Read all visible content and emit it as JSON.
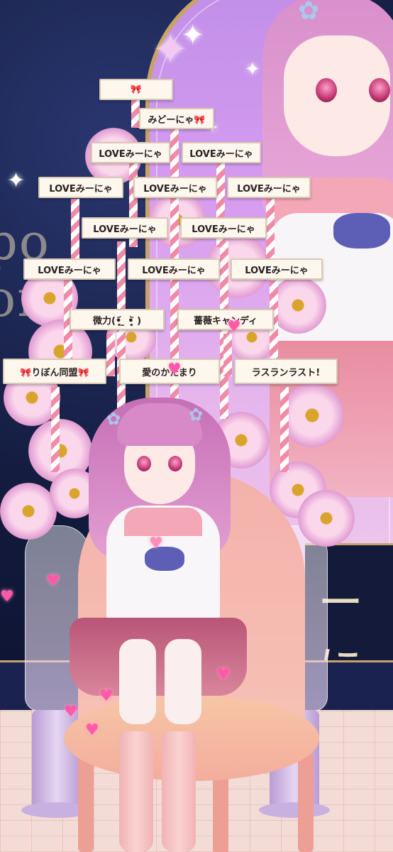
{
  "signs": [
    {
      "id": "sign-1",
      "text": "🎀"
    },
    {
      "id": "sign-2",
      "text": "みどーにゃ🎀"
    },
    {
      "id": "sign-3",
      "text": "LOVEみーにゃ"
    },
    {
      "id": "sign-4",
      "text": "LOVEみーにゃ"
    },
    {
      "id": "sign-5",
      "text": "LOVEみーにゃ"
    },
    {
      "id": "sign-6",
      "text": "LOVEみーにゃ"
    },
    {
      "id": "sign-7",
      "text": "LOVEみーにゃ"
    },
    {
      "id": "sign-8",
      "text": "LOVEみーにゃ"
    },
    {
      "id": "sign-9",
      "text": "LOVEみーにゃ"
    },
    {
      "id": "sign-10",
      "text": "LOVEみーにゃ"
    },
    {
      "id": "sign-11",
      "text": "LOVEみーにゃ"
    },
    {
      "id": "sign-12",
      "text": "LOVEみーにゃ"
    },
    {
      "id": "sign-13",
      "text": "微力(•̥̥̥̥᷄ ̫ •̥̥̥̥᷅ )"
    },
    {
      "id": "sign-14",
      "text": "薔薇キャンディ"
    },
    {
      "id": "sign-15",
      "text": "🎀りぼん同盟🎀"
    },
    {
      "id": "sign-16",
      "text": "愛のかたまり"
    },
    {
      "id": "sign-17",
      "text": "ラスランラスト!"
    }
  ],
  "background": {
    "right_panel_text": "ーに",
    "sign_colors": {
      "pole_stripe": "#f08aa6",
      "board": "#fdf7ee",
      "board_border": "#d9c9b4"
    },
    "accent_colors": {
      "arch_gold": "#c7a36a",
      "night_sky": "#121a3c",
      "arch_pink": "#d69cf0"
    }
  },
  "icons": [
    "sparkle-icon",
    "heart-icon",
    "cosmos-flower-icon",
    "hair-flower-icon"
  ]
}
